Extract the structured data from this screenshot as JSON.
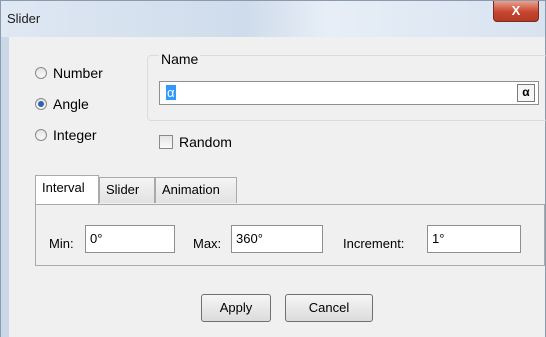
{
  "window": {
    "title": "Slider",
    "close_label": "X"
  },
  "type_options": [
    {
      "label": "Number",
      "selected": false
    },
    {
      "label": "Angle",
      "selected": true
    },
    {
      "label": "Integer",
      "selected": false
    }
  ],
  "name": {
    "legend": "Name",
    "value": "α",
    "symbol_button": "α"
  },
  "random": {
    "label": "Random",
    "checked": false
  },
  "tabs": [
    {
      "label": "Interval",
      "active": true
    },
    {
      "label": "Slider",
      "active": false
    },
    {
      "label": "Animation",
      "active": false
    }
  ],
  "interval": {
    "min_label": "Min:",
    "min_value": "0°",
    "max_label": "Max:",
    "max_value": "360°",
    "increment_label": "Increment:",
    "increment_value": "1°"
  },
  "buttons": {
    "apply": "Apply",
    "cancel": "Cancel"
  }
}
